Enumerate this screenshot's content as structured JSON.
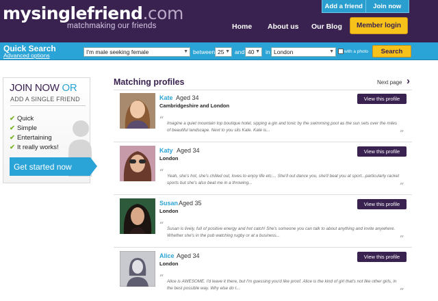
{
  "header": {
    "logo_main": "mysinglefriend",
    "logo_suffix": ".com",
    "tagline": "matchmaking our friends",
    "add_friend": "Add a friend",
    "join_now": "Join now",
    "nav": {
      "home": "Home",
      "about": "About us",
      "blog": "Our Blog"
    },
    "member_login": "Member login"
  },
  "search": {
    "title": "Quick Search",
    "advanced": "Advanced options",
    "seeking": "I'm male seeking female",
    "between": "between",
    "age_min": "25",
    "and": "and",
    "age_max": "40",
    "in": "in",
    "location": "London",
    "with_photo": "with a photo",
    "button": "Search"
  },
  "sidebar": {
    "join": "JOIN NOW",
    "or": "OR",
    "add": "ADD A SINGLE FRIEND",
    "features": [
      "Quick",
      "Simple",
      "Entertaining",
      "It really works!"
    ],
    "cta": "Get started now"
  },
  "main": {
    "title": "Matching profiles",
    "next_page": "Next page",
    "view_label": "View this profile",
    "profiles": [
      {
        "name": "Kate",
        "aged": "Aged 34",
        "location": "Cambridgeshire and London",
        "desc": "Imagine a quiet mountain top boutique hotel, sipping a gin and tonic by the swimming pool as the sun sets over the miles of beautiful landscape. Next to you sits Kate. Kate is..."
      },
      {
        "name": "Katy",
        "aged": "Aged 34",
        "location": "London",
        "desc": "Yeah, she's hot, she's chilled out, loves to enjoy life etc.... She'll out dance you, she'll beat you at sport...particularly racket sports but she's also beat me in a throwing..."
      },
      {
        "name": "Susan",
        "aged": "Aged 35",
        "location": "London",
        "desc": "Susan is lively, full of positive energy and hot catch! She's someone you can talk to about anything and invite anywhere. Whether she's in the pub watching rugby or at a business..."
      },
      {
        "name": "Alice",
        "aged": "Aged 34",
        "location": "London",
        "desc": "Alice is AWESOME. I'd leave it there, but I'm guessing you'd like proof. Alice is the kind of girl that's not like other girls, in the best possible way. Why else do I..."
      }
    ]
  },
  "colors": {
    "brand_purple": "#3a2250",
    "accent_blue": "#2aa3d6",
    "accent_yellow": "#f7c21a",
    "tick_green": "#7bb526"
  }
}
